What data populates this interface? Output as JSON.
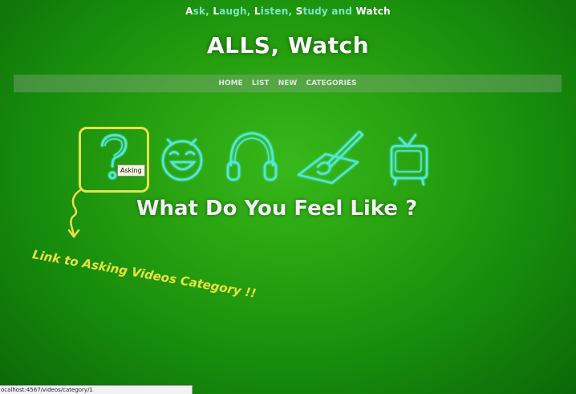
{
  "tagline": {
    "segments": [
      {
        "text": "A",
        "color": "#ffffff"
      },
      {
        "text": "sk, ",
        "color": "#7fe3c8"
      },
      {
        "text": "L",
        "color": "#ffffff"
      },
      {
        "text": "augh, ",
        "color": "#7fe3c8"
      },
      {
        "text": "L",
        "color": "#ffffff"
      },
      {
        "text": "isten, ",
        "color": "#7fe3c8"
      },
      {
        "text": "S",
        "color": "#ffffff"
      },
      {
        "text": "tudy and ",
        "color": "#7fe3c8"
      },
      {
        "text": "Watch",
        "color": "#ffffff"
      }
    ]
  },
  "site_title": "ALLS, Watch",
  "nav": {
    "items": [
      {
        "label": "HOME"
      },
      {
        "label": "LIST"
      },
      {
        "label": "NEW"
      },
      {
        "label": "CATEGORIES"
      }
    ]
  },
  "icons": [
    {
      "name": "question-mark-icon",
      "selected": true
    },
    {
      "name": "laughing-face-icon",
      "selected": false
    },
    {
      "name": "headphones-icon",
      "selected": false
    },
    {
      "name": "pen-and-paper-icon",
      "selected": false
    },
    {
      "name": "television-icon",
      "selected": false
    }
  ],
  "tooltip": "Asking",
  "headline": "What Do You Feel Like ?",
  "annotation": "Link to Asking Videos Category !!",
  "status_bar": "ocalhost:4567/videos/category/1",
  "colors": {
    "background": "#27a010",
    "accent_yellow": "#e8e04a",
    "icon_glow": "#52e8d8"
  }
}
